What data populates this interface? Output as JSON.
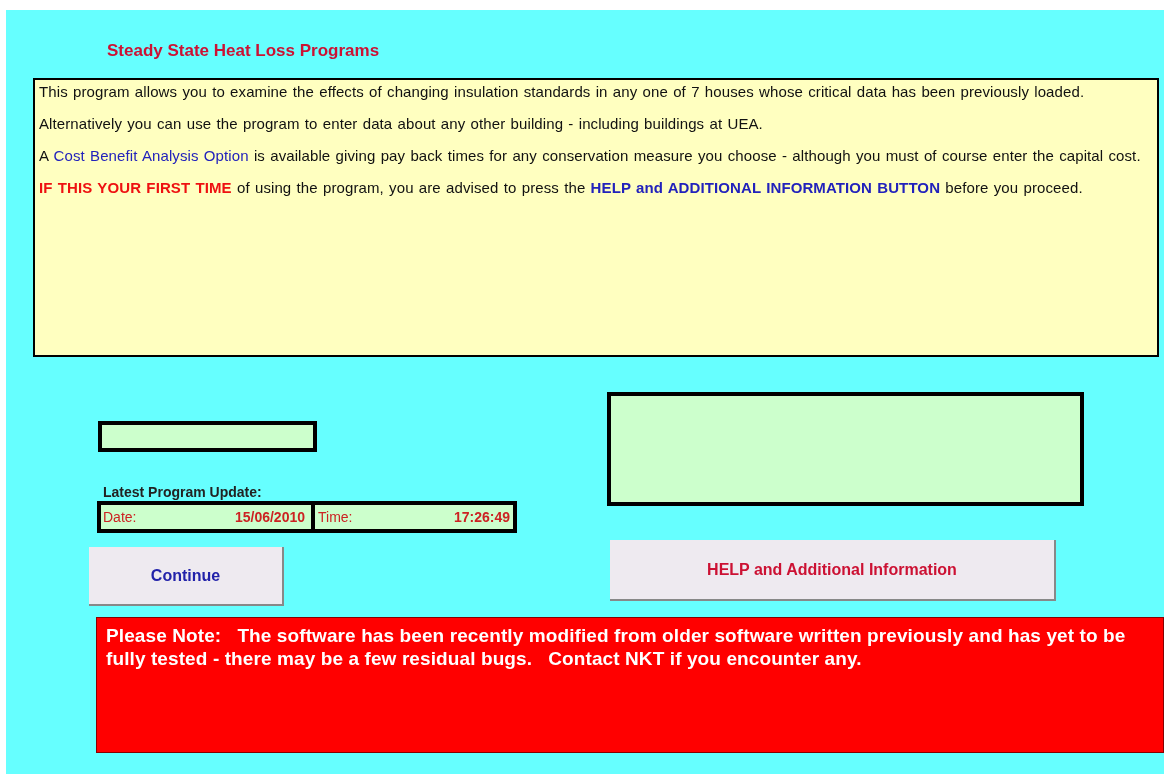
{
  "title": "Steady State Heat Loss Programs",
  "intro": [
    {
      "segments": [
        {
          "kind": "plain",
          "text": "This program allows you to examine the effects of changing insulation standards  in any one of 7 houses whose critical data has been previously loaded."
        }
      ]
    },
    {
      "segments": [
        {
          "kind": "plain",
          "text": "Alternatively you can use the program to enter data about any other building - including buildings at UEA."
        }
      ]
    },
    {
      "segments": [
        {
          "kind": "plain",
          "text": "A "
        },
        {
          "kind": "link",
          "text": "Cost Benefit Analysis Option"
        },
        {
          "kind": "plain",
          "text": " is available giving pay back times for any conservation measure you choose - although you must of course enter the capital cost."
        }
      ]
    },
    {
      "segments": [
        {
          "kind": "warning",
          "text": "IF THIS YOUR FIRST TIME"
        },
        {
          "kind": "plain",
          "text": " of using the program,  you are advised to press the "
        },
        {
          "kind": "emphasis",
          "text": "HELP and ADDITIONAL  INFORMATION BUTTON"
        },
        {
          "kind": "plain",
          "text": " before you proceed."
        }
      ]
    }
  ],
  "update": {
    "label": "Latest Program Update:",
    "date_label": "Date:",
    "date": "15/06/2010",
    "time_label": "Time:",
    "time": "17:26:49"
  },
  "continue_button": "Continue",
  "help_button": "HELP and Additional Information",
  "note": "Please Note:   The software has been recently modified from older software written previously and has yet to be fully tested - there may be a few residual bugs.   Contact NKT if you encounter any."
}
